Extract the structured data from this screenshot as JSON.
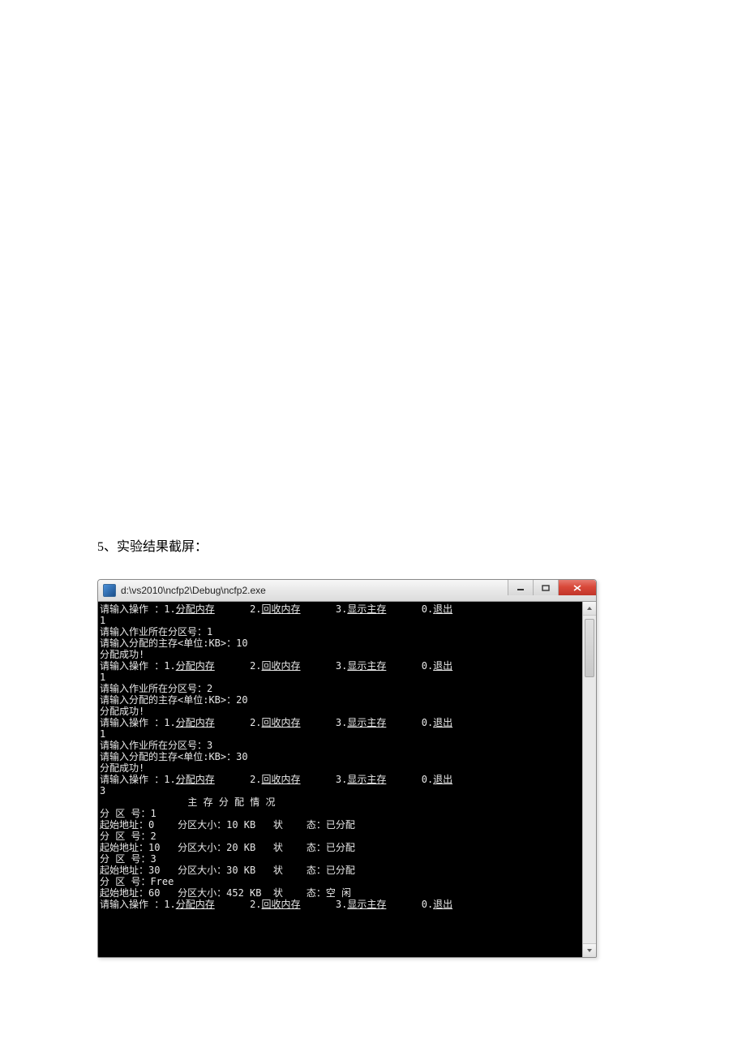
{
  "heading": "5、实验结果截屏：",
  "window_title": "d:\\vs2010\\ncfp2\\Debug\\ncfp2.exe",
  "menu_line": "请输入操作 ：1.分配内存      2.回收内存      3.显示主存      0.退出",
  "console": {
    "lines": [
      {
        "t": "menu"
      },
      {
        "t": "txt",
        "v": "1"
      },
      {
        "t": "txt",
        "v": "请输入作业所在分区号：1"
      },
      {
        "t": "txt",
        "v": "请输入分配的主存<单位:KB>：10"
      },
      {
        "t": "txt",
        "v": "分配成功!"
      },
      {
        "t": "menu"
      },
      {
        "t": "txt",
        "v": "1"
      },
      {
        "t": "txt",
        "v": "请输入作业所在分区号：2"
      },
      {
        "t": "txt",
        "v": "请输入分配的主存<单位:KB>：20"
      },
      {
        "t": "txt",
        "v": "分配成功!"
      },
      {
        "t": "menu"
      },
      {
        "t": "txt",
        "v": "1"
      },
      {
        "t": "txt",
        "v": "请输入作业所在分区号：3"
      },
      {
        "t": "txt",
        "v": "请输入分配的主存<单位:KB>：30"
      },
      {
        "t": "txt",
        "v": "分配成功!"
      },
      {
        "t": "menu"
      },
      {
        "t": "txt",
        "v": "3"
      },
      {
        "t": "txt",
        "v": "               主 存 分 配 情 况"
      },
      {
        "t": "txt",
        "v": "分 区 号：1"
      },
      {
        "t": "txt",
        "v": "起始地址：0    分区大小：10 KB   状    态：已分配"
      },
      {
        "t": "txt",
        "v": "分 区 号：2"
      },
      {
        "t": "txt",
        "v": "起始地址：10   分区大小：20 KB   状    态：已分配"
      },
      {
        "t": "txt",
        "v": "分 区 号：3"
      },
      {
        "t": "txt",
        "v": "起始地址：30   分区大小：30 KB   状    态：已分配"
      },
      {
        "t": "txt",
        "v": "分 区 号：Free"
      },
      {
        "t": "txt",
        "v": "起始地址：60   分区大小：452 KB  状    态：空 闲"
      },
      {
        "t": "txt",
        "v": ""
      },
      {
        "t": "menu"
      }
    ]
  },
  "partitions": [
    {
      "id": "1",
      "start": 0,
      "size_kb": 10,
      "status": "已分配"
    },
    {
      "id": "2",
      "start": 10,
      "size_kb": 20,
      "status": "已分配"
    },
    {
      "id": "3",
      "start": 30,
      "size_kb": 30,
      "status": "已分配"
    },
    {
      "id": "Free",
      "start": 60,
      "size_kb": 452,
      "status": "空 闲"
    }
  ],
  "menu_parts": {
    "prefix": "请输入操作 ：",
    "opt1": "1.分配内存",
    "opt2": "2.回收内存",
    "opt3": "3.显示主存",
    "opt0": "0.退出"
  }
}
